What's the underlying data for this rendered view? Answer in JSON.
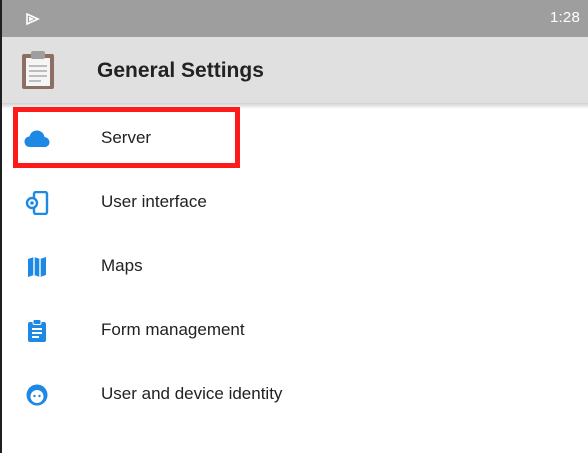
{
  "status_bar": {
    "time": "1:28",
    "play_icon": "play-icon"
  },
  "toolbar": {
    "icon": "clipboard-icon",
    "title": "General Settings"
  },
  "menu": {
    "items": [
      {
        "label": "Server",
        "icon": "cloud-icon"
      },
      {
        "label": "User interface",
        "icon": "device-settings-icon"
      },
      {
        "label": "Maps",
        "icon": "map-icon"
      },
      {
        "label": "Form management",
        "icon": "clipboard-list-icon"
      },
      {
        "label": "User and device identity",
        "icon": "face-icon"
      }
    ]
  },
  "colors": {
    "icon_accent": "#1e88e5",
    "status_bar": "#9e9e9e",
    "toolbar": "#e0e0e0",
    "highlight": "#ff1a1a"
  }
}
